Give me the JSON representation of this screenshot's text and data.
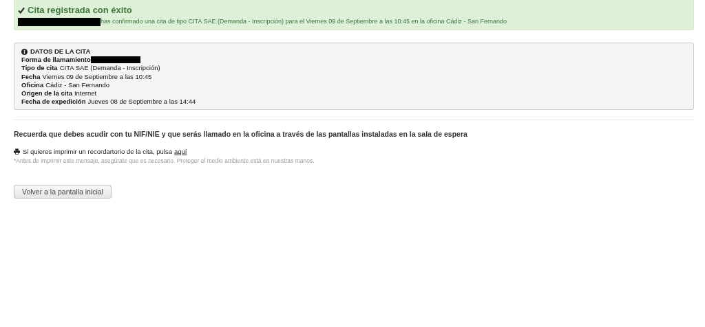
{
  "alert": {
    "title": "Cita registrada con éxito",
    "redacted": true,
    "message": "has confirmado una cita de tipo CITA SAE (Demanda - Inscripción) para el Viernes 09 de Septiembre a las 10:45 en la oficina Cádiz - San Fernando"
  },
  "details": {
    "title": "DATOS DE LA CITA",
    "fields": [
      {
        "label": "Forma de llamamiento",
        "redacted": true
      },
      {
        "label": "Tipo de cita",
        "value": "CITA SAE (Demanda - Inscripción)"
      },
      {
        "label": "Fecha",
        "value": "Viernes 09 de Septiembre a las 10:45"
      },
      {
        "label": "Oficina",
        "value": "Cádiz - San Fernando"
      },
      {
        "label": "Origen de la cita",
        "value": "Internet"
      },
      {
        "label": "Fecha de expedición",
        "value": "Jueves 08 de Septiembre a las 14:44"
      }
    ]
  },
  "reminder": "Recuerda que debes acudir con tu NIF/NIE y que serás llamado en la oficina a través de las pantallas instaladas en la sala de espera",
  "print": {
    "text": "Si quieres imprimir un recordartorio de la cita, pulsa",
    "link": "aquí"
  },
  "note": "*Antes de imprimir este mensaje, asegúrate que es necesario. Proteger el medio ambiente está en nuestras manos.",
  "button": "Volver a la pantalla inicial"
}
